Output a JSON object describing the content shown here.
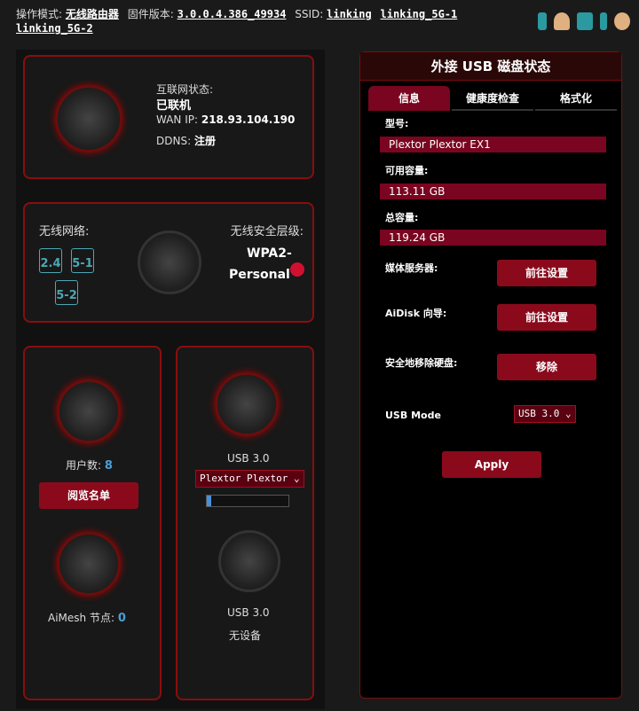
{
  "topbar": {
    "mode_label": "操作模式:",
    "mode_value": "无线路由器",
    "fw_label": "固件版本:",
    "fw_value": "3.0.0.4.386_49934",
    "ssid_label": "SSID:",
    "ssids": [
      "linking",
      "linking_5G-1",
      "linking_5G-2"
    ],
    "icons": [
      "phone-icon",
      "users-icon",
      "network-icon",
      "usb-icon",
      "settings-gear-icon"
    ]
  },
  "internet": {
    "status_label": "互联网状态:",
    "status_value": "已联机",
    "wan_label": "WAN IP:",
    "wan_value": "218.93.104.190",
    "ddns_label": "DDNS:",
    "ddns_value": "注册"
  },
  "wireless": {
    "label": "无线网络:",
    "bands": [
      "2.4",
      "5-1",
      "5-2"
    ],
    "security_label": "无线安全层级:",
    "security_value_1": "WPA2-",
    "security_value_2": "Personal"
  },
  "clients": {
    "label": "用户数:",
    "count": "8",
    "button": "阅览名单"
  },
  "aimesh": {
    "label": "AiMesh 节点:",
    "count": "0"
  },
  "usb1": {
    "label": "USB 3.0",
    "device": "Plextor Plextor",
    "usage_percent": 5
  },
  "usb2": {
    "label": "USB 3.0",
    "status": "无设备"
  },
  "usb_panel": {
    "title": "外接 USB 磁盘状态",
    "tabs": [
      "信息",
      "健康度检查",
      "格式化"
    ],
    "active_tab": 0,
    "model_label": "型号:",
    "model": "Plextor Plextor EX1",
    "free_label": "可用容量:",
    "free": "113.11 GB",
    "total_label": "总容量:",
    "total": "119.24 GB",
    "media_label": "媒体服务器:",
    "media_btn": "前往设置",
    "aidisk_label": "AiDisk 向导:",
    "aidisk_btn": "前往设置",
    "eject_label": "安全地移除硬盘:",
    "eject_btn": "移除",
    "mode_label": "USB Mode",
    "mode_value": "USB 3.0",
    "apply": "Apply"
  },
  "colors": {
    "accent": "#8a0a1c",
    "band": "#4da6b5",
    "usage": "#4a90d9"
  }
}
